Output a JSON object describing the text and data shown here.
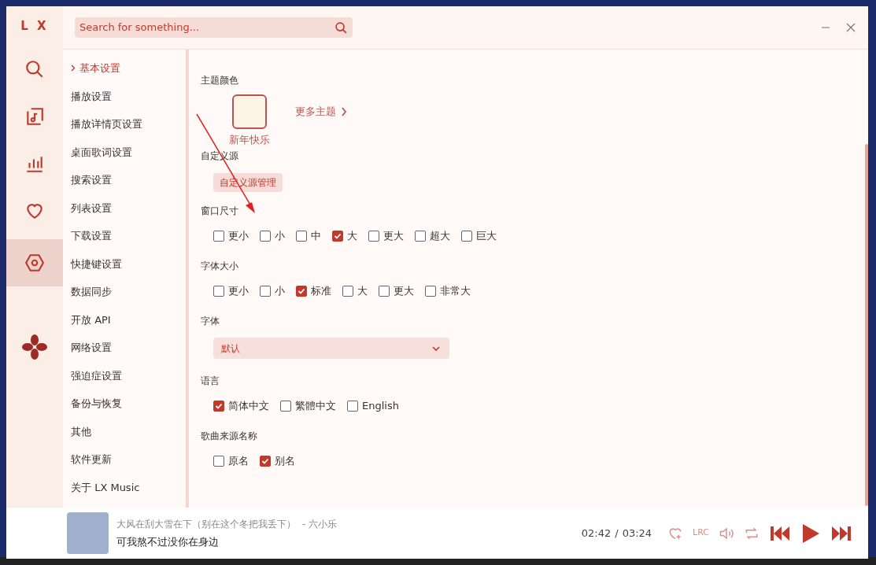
{
  "app": {
    "logo": "L X"
  },
  "search": {
    "placeholder": "Search for something..."
  },
  "nav": [
    {
      "kind": "search",
      "selected": false
    },
    {
      "kind": "music",
      "selected": false
    },
    {
      "kind": "chart",
      "selected": false
    },
    {
      "kind": "heart",
      "selected": false
    },
    {
      "kind": "settings",
      "selected": true
    }
  ],
  "settings_menu": [
    {
      "label": "基本设置",
      "selected": true
    },
    {
      "label": "播放设置",
      "selected": false
    },
    {
      "label": "播放详情页设置",
      "selected": false
    },
    {
      "label": "桌面歌词设置",
      "selected": false
    },
    {
      "label": "搜索设置",
      "selected": false
    },
    {
      "label": "列表设置",
      "selected": false
    },
    {
      "label": "下载设置",
      "selected": false
    },
    {
      "label": "快捷键设置",
      "selected": false
    },
    {
      "label": "数据同步",
      "selected": false
    },
    {
      "label": "开放 API",
      "selected": false
    },
    {
      "label": "网络设置",
      "selected": false
    },
    {
      "label": "强迫症设置",
      "selected": false
    },
    {
      "label": "备份与恢复",
      "selected": false
    },
    {
      "label": "其他",
      "selected": false
    },
    {
      "label": "软件更新",
      "selected": false
    },
    {
      "label": "关于 LX Music",
      "selected": false
    }
  ],
  "sections": [
    {
      "kind": "theme",
      "title": "主题颜色",
      "theme_name": "新年快乐",
      "more": "更多主题"
    },
    {
      "kind": "button",
      "title": "自定义源",
      "button": "自定义源管理"
    },
    {
      "kind": "checkboxes",
      "title": "窗口尺寸",
      "options": [
        {
          "label": "更小",
          "checked": false
        },
        {
          "label": "小",
          "checked": false
        },
        {
          "label": "中",
          "checked": false
        },
        {
          "label": "大",
          "checked": true
        },
        {
          "label": "更大",
          "checked": false
        },
        {
          "label": "超大",
          "checked": false
        },
        {
          "label": "巨大",
          "checked": false
        }
      ]
    },
    {
      "kind": "checkboxes",
      "title": "字体大小",
      "options": [
        {
          "label": "更小",
          "checked": false
        },
        {
          "label": "小",
          "checked": false
        },
        {
          "label": "标准",
          "checked": true
        },
        {
          "label": "大",
          "checked": false
        },
        {
          "label": "更大",
          "checked": false
        },
        {
          "label": "非常大",
          "checked": false
        }
      ]
    },
    {
      "kind": "select",
      "title": "字体",
      "value": "默认"
    },
    {
      "kind": "checkboxes",
      "title": "语言",
      "options": [
        {
          "label": "简体中文",
          "checked": true
        },
        {
          "label": "繁體中文",
          "checked": false
        },
        {
          "label": "English",
          "checked": false
        }
      ]
    },
    {
      "kind": "checkboxes",
      "title": "歌曲来源名称",
      "options": [
        {
          "label": "原名",
          "checked": false
        },
        {
          "label": "别名",
          "checked": true
        }
      ]
    }
  ],
  "player": {
    "title": "大风在刮大雪在下（别在这个冬把我丢下）",
    "artist": "- 六小乐",
    "lyric": "可我熬不过没你在身边",
    "time": "02:42",
    "separator": "/",
    "duration": "03:24",
    "lyric_toggle": "LRC"
  }
}
